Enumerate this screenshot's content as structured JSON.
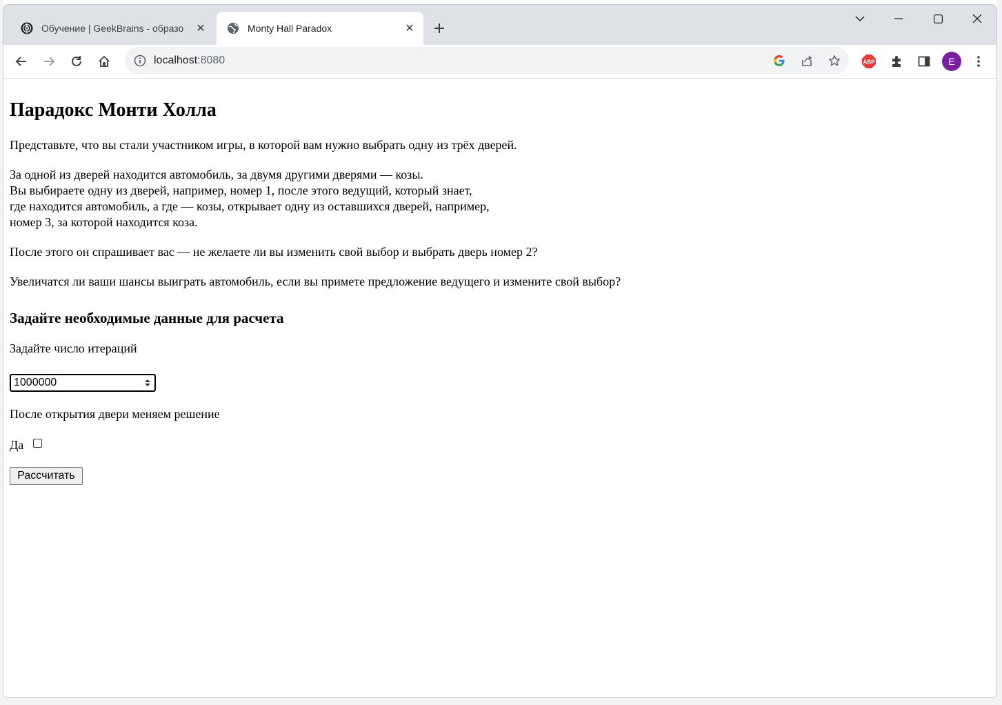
{
  "browser": {
    "tabs": [
      {
        "title": "Обучение | GeekBrains - образо",
        "active": false
      },
      {
        "title": "Monty Hall Paradox",
        "active": true
      }
    ],
    "address": {
      "host": "localhost",
      "port": ":8080"
    },
    "profile_initial": "E",
    "adblock_label": "ABP",
    "colors": {
      "profile": "#7b1fa2",
      "adblock": "#e53935",
      "tabstrip": "#dee1e6"
    }
  },
  "page": {
    "heading": "Парадокс Монти Холла",
    "intro": "Представьте, что вы стали участником игры, в которой вам нужно выбрать одну из трёх дверей.",
    "story_lines": [
      "За одной из дверей находится автомобиль, за двумя другими дверями — козы.",
      "Вы выбираете одну из дверей, например, номер 1, после этого ведущий, который знает,",
      "где находится автомобиль, а где — козы, открывает одну из оставшихся дверей, например,",
      "номер 3, за которой находится коза."
    ],
    "question1": "После этого он спрашивает вас — не желаете ли вы изменить свой выбор и выбрать дверь номер 2?",
    "question2": "Увеличатся ли ваши шансы выиграть автомобиль, если вы примете предложение ведущего и измените свой выбор?",
    "form_heading": "Задайте необходимые данные для расчета",
    "iterations_label": "Задайте число итераций",
    "iterations_value": "1000000",
    "switch_label": "После открытия двери меняем решение",
    "yes_label": "Да",
    "yes_checked": false,
    "submit_label": "Рассчитать"
  }
}
